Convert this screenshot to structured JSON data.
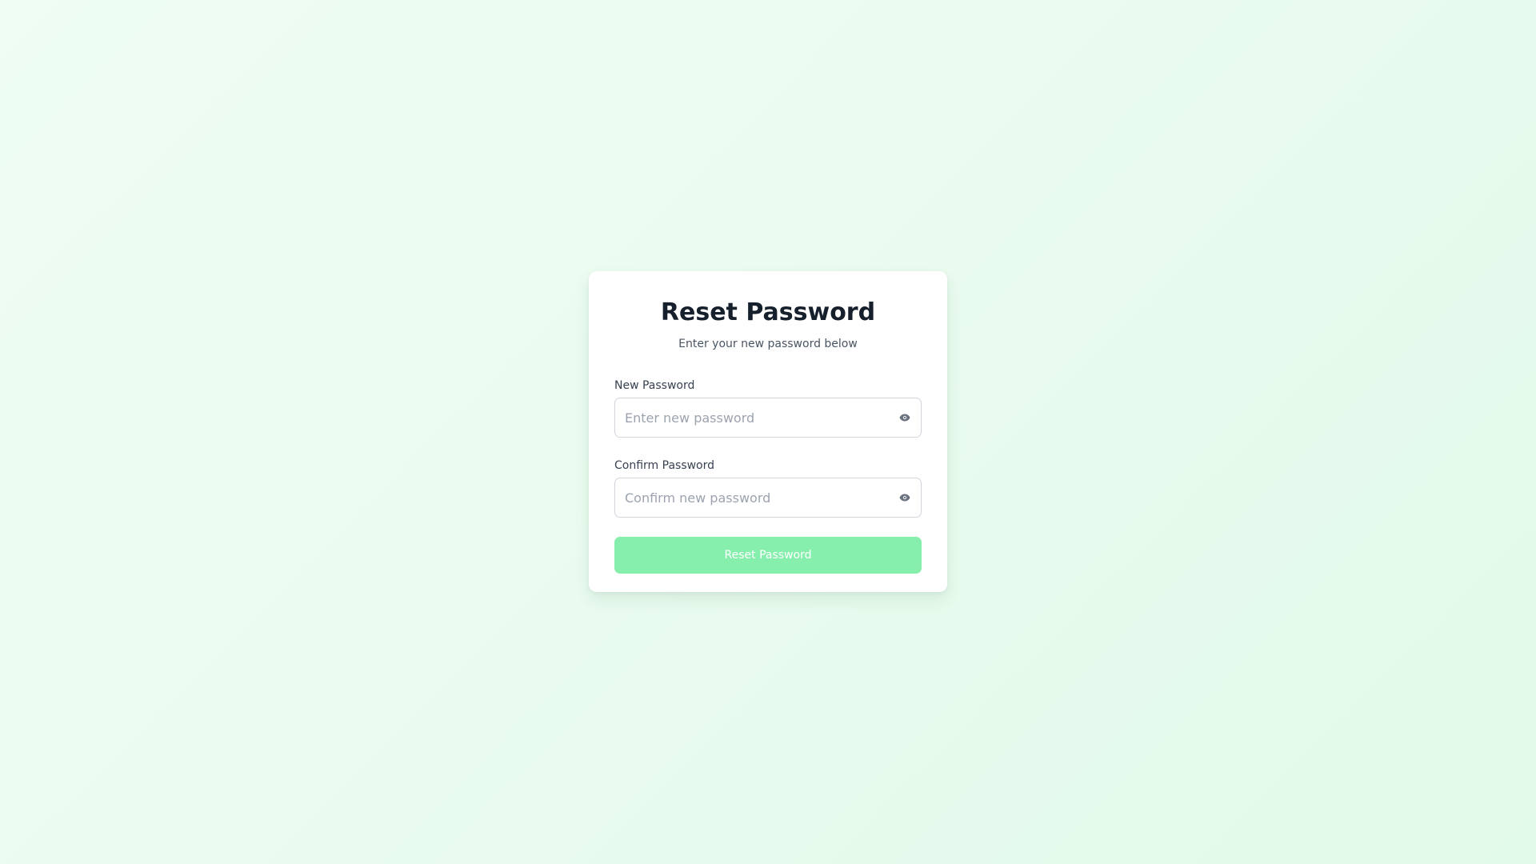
{
  "form": {
    "title": "Reset Password",
    "subtitle": "Enter your new password below",
    "new_password": {
      "label": "New Password",
      "placeholder": "Enter new password",
      "value": "",
      "toggle_icon": "eye-icon"
    },
    "confirm_password": {
      "label": "Confirm Password",
      "placeholder": "Confirm new password",
      "value": "",
      "toggle_icon": "eye-icon"
    },
    "submit_label": "Reset Password"
  },
  "colors": {
    "background": "#ecfcf1",
    "card": "#ffffff",
    "title": "#161f2c",
    "subtitle": "#4a5563",
    "input_border": "#d1d5db",
    "placeholder": "#9ca3af",
    "button": "#87efad",
    "button_text": "#ffffff"
  }
}
